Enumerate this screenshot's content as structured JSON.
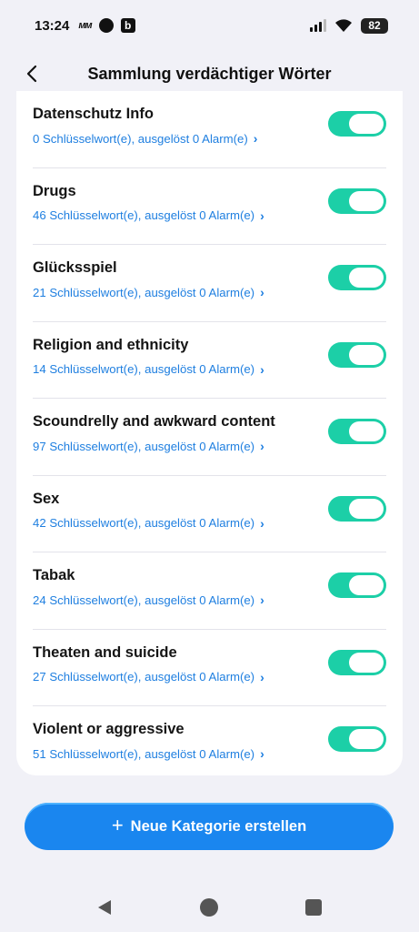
{
  "status_bar": {
    "time": "13:24",
    "battery": "82"
  },
  "header": {
    "title": "Sammlung verdächtiger Wörter"
  },
  "categories": [
    {
      "title": "Datenschutz Info",
      "subtitle": "0 Schlüsselwort(e), ausgelöst 0 Alarm(e)",
      "enabled": true
    },
    {
      "title": "Drugs",
      "subtitle": "46 Schlüsselwort(e), ausgelöst 0 Alarm(e)",
      "enabled": true
    },
    {
      "title": "Glücksspiel",
      "subtitle": "21 Schlüsselwort(e), ausgelöst 0 Alarm(e)",
      "enabled": true
    },
    {
      "title": "Religion and ethnicity",
      "subtitle": "14 Schlüsselwort(e), ausgelöst 0 Alarm(e)",
      "enabled": true
    },
    {
      "title": "Scoundrelly and awkward content",
      "subtitle": "97 Schlüsselwort(e), ausgelöst 0 Alarm(e)",
      "enabled": true
    },
    {
      "title": "Sex",
      "subtitle": "42 Schlüsselwort(e), ausgelöst 0 Alarm(e)",
      "enabled": true
    },
    {
      "title": "Tabak",
      "subtitle": "24 Schlüsselwort(e), ausgelöst 0 Alarm(e)",
      "enabled": true
    },
    {
      "title": "Theaten and suicide",
      "subtitle": "27 Schlüsselwort(e), ausgelöst 0 Alarm(e)",
      "enabled": true
    },
    {
      "title": "Violent or aggressive",
      "subtitle": "51 Schlüsselwort(e), ausgelöst 0 Alarm(e)",
      "enabled": true
    }
  ],
  "create_button": {
    "label": "Neue Kategorie erstellen"
  },
  "colors": {
    "accent": "#1a86ef",
    "toggle_on": "#1ccfa7",
    "link": "#1f7fe0",
    "background": "#f1f1f7"
  }
}
